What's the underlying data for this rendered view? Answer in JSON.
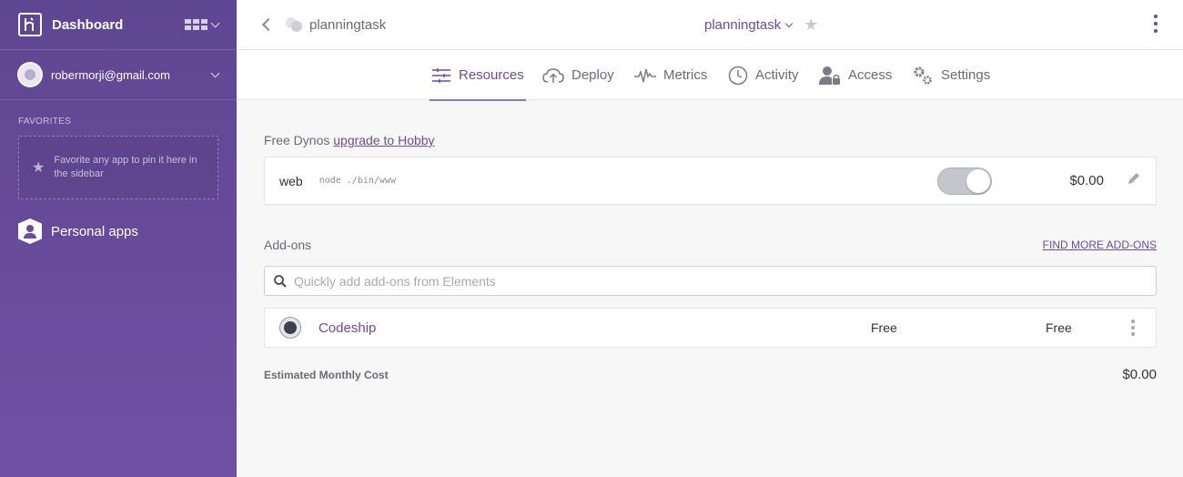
{
  "sidebar": {
    "title": "Dashboard",
    "user_email": "robermorji@gmail.com",
    "favorites_label": "FAVORITES",
    "favorites_hint": "Favorite any app to pin it here in the sidebar",
    "personal_apps_label": "Personal apps"
  },
  "header": {
    "breadcrumb_app": "planningtask",
    "center_app_name": "planningtask"
  },
  "tabs": [
    {
      "label": "Resources",
      "icon": "resources-icon",
      "active": true
    },
    {
      "label": "Deploy",
      "icon": "deploy-icon",
      "active": false
    },
    {
      "label": "Metrics",
      "icon": "metrics-icon",
      "active": false
    },
    {
      "label": "Activity",
      "icon": "activity-icon",
      "active": false
    },
    {
      "label": "Access",
      "icon": "access-icon",
      "active": false
    },
    {
      "label": "Settings",
      "icon": "settings-icon",
      "active": false
    }
  ],
  "dynos": {
    "label_prefix": "Free Dynos",
    "upgrade_link": "upgrade to Hobby",
    "items": [
      {
        "name": "web",
        "command": "node ./bin/www",
        "enabled": true,
        "cost": "$0.00"
      }
    ]
  },
  "addons": {
    "label": "Add-ons",
    "find_more": "FIND MORE ADD-ONS",
    "search_placeholder": "Quickly add add-ons from Elements",
    "items": [
      {
        "name": "Codeship",
        "plan": "Free",
        "price": "Free"
      }
    ]
  },
  "estimate": {
    "label": "Estimated Monthly Cost",
    "value": "$0.00"
  },
  "colors": {
    "sidebar": "#694c9c",
    "accent": "#6a4d9a"
  }
}
